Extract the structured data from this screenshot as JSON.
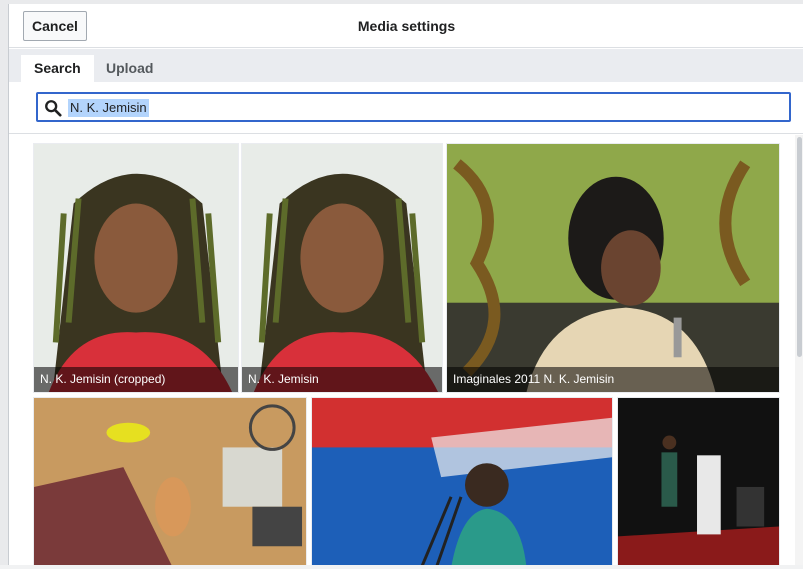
{
  "header": {
    "cancel_label": "Cancel",
    "title": "Media settings"
  },
  "tabs": [
    {
      "label": "Search",
      "active": true
    },
    {
      "label": "Upload",
      "active": false
    }
  ],
  "search": {
    "value": "N. K. Jemisin",
    "icon": "search-icon"
  },
  "results": [
    {
      "caption": "N. K. Jemisin (cropped)"
    },
    {
      "caption": "N. K. Jemisin"
    },
    {
      "caption": "Imaginales 2011 N. K. Jemisin"
    },
    {
      "caption": ""
    },
    {
      "caption": ""
    },
    {
      "caption": ""
    }
  ],
  "colors": {
    "accent": "#3366cc",
    "tab_bar": "#eaecf0"
  }
}
